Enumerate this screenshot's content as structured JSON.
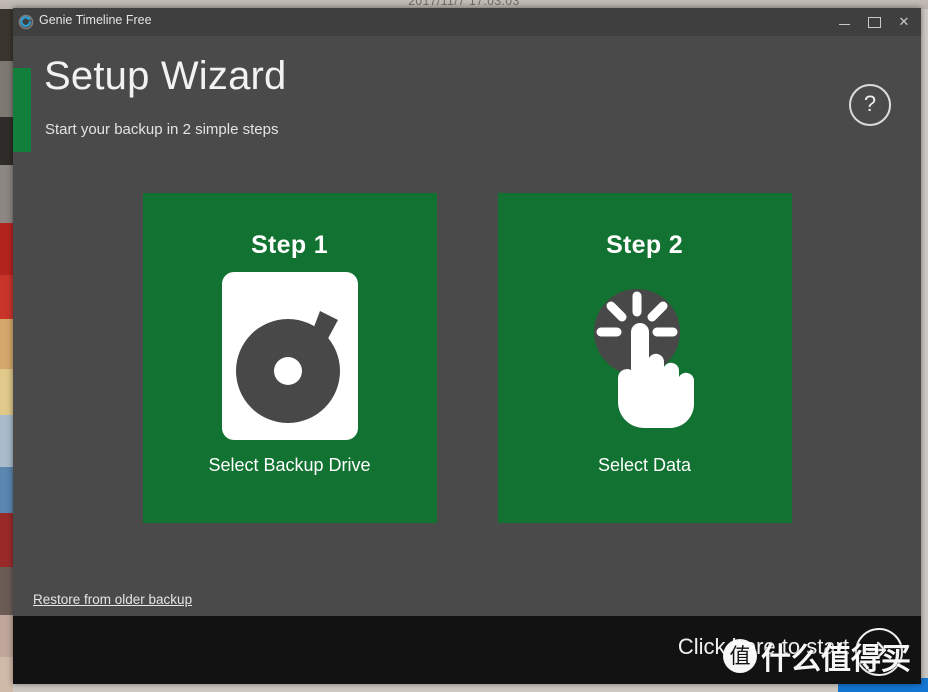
{
  "desktop": {
    "date_text": "2017/11/7 17:03:03",
    "taskbar_accent_color": "#1477d4"
  },
  "window": {
    "titlebar": {
      "app_icon": "circular-arrow-icon",
      "title": "Genie Timeline Free",
      "minimize_label": "Minimize",
      "maximize_label": "Maximize",
      "close_label": "✕"
    },
    "header": {
      "accent_color": "#12803c",
      "title": "Setup Wizard",
      "subtitle": "Start your backup in 2 simple steps",
      "help_label": "?"
    },
    "cards": [
      {
        "title": "Step 1",
        "label": "Select Backup Drive",
        "icon": "backup-drive-disk-icon",
        "color": "#127232"
      },
      {
        "title": "Step 2",
        "label": "Select Data",
        "icon": "pointing-hand-click-icon",
        "color": "#127232"
      }
    ],
    "restore_link": "Restore from older backup",
    "bottombar": {
      "background_color": "#121212",
      "start_text": "Click here to start",
      "arrow_icon": "arrow-right-circle-icon"
    }
  },
  "watermark": {
    "logo_glyph": "值",
    "text": "什么值得买"
  }
}
